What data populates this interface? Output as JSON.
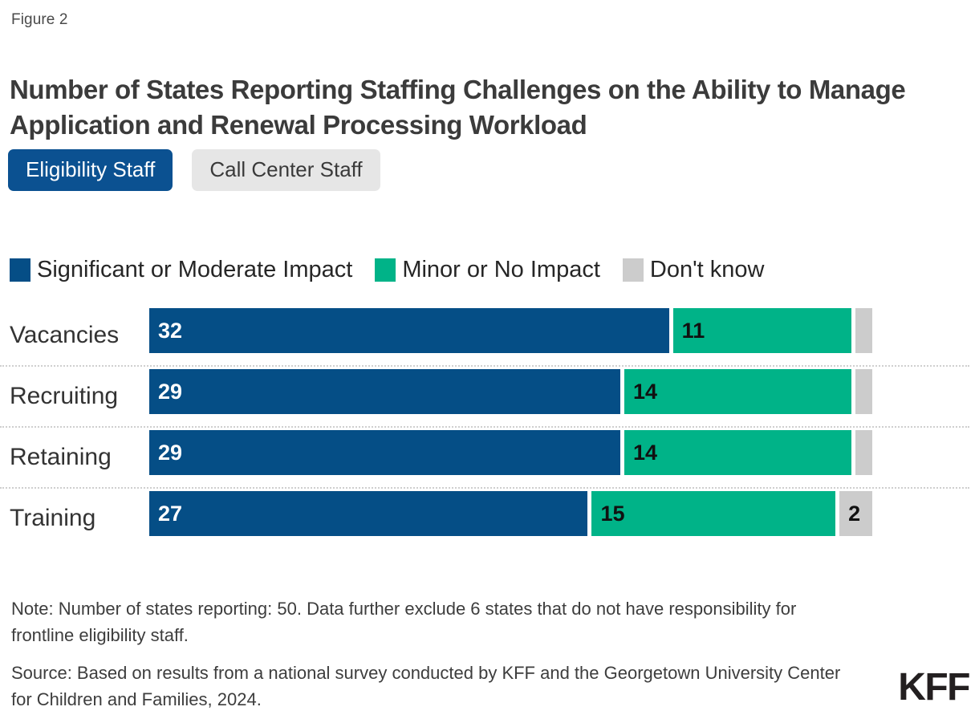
{
  "figure_label": "Figure 2",
  "title": "Number of States Reporting Staffing Challenges on the Ability to Manage Application and Renewal Processing Workload",
  "tabs": [
    {
      "label": "Eligibility Staff",
      "active": true
    },
    {
      "label": "Call Center Staff",
      "active": false
    }
  ],
  "note": "Note: Number of states reporting: 50. Data further exclude 6 states that do not have responsibility for frontline eligibility staff.",
  "source": "Source: Based on results from a national survey conducted by KFF and the Georgetown University Center for Children and Families, 2024.",
  "logo": "KFF",
  "colors": {
    "significant": "#054e86",
    "minor": "#00b388",
    "dont_know": "#cccccc",
    "tab_active_bg": "#0b5191",
    "tab_inactive_bg": "#e6e6e6",
    "title_text": "#3b3b3b"
  },
  "chart_data": {
    "type": "bar",
    "orientation": "horizontal",
    "stacked": true,
    "title": "Number of States Reporting Staffing Challenges on the Ability to Manage Application and Renewal Processing Workload",
    "xlabel": "",
    "ylabel": "",
    "xlim": [
      0,
      50
    ],
    "grid": false,
    "legend_position": "top-left",
    "categories": [
      "Vacancies",
      "Recruiting",
      "Retaining",
      "Training"
    ],
    "series": [
      {
        "name": "Significant or Moderate Impact",
        "color": "#054e86",
        "values": [
          32,
          29,
          29,
          27
        ]
      },
      {
        "name": "Minor or No Impact",
        "color": "#00b388",
        "values": [
          11,
          14,
          14,
          15
        ]
      },
      {
        "name": "Don't know",
        "color": "#cccccc",
        "values": [
          1,
          1,
          1,
          2
        ]
      }
    ],
    "bar_labels": [
      [
        "32",
        "11",
        ""
      ],
      [
        "29",
        "14",
        ""
      ],
      [
        "29",
        "14",
        ""
      ],
      [
        "27",
        "15",
        "2"
      ]
    ]
  }
}
